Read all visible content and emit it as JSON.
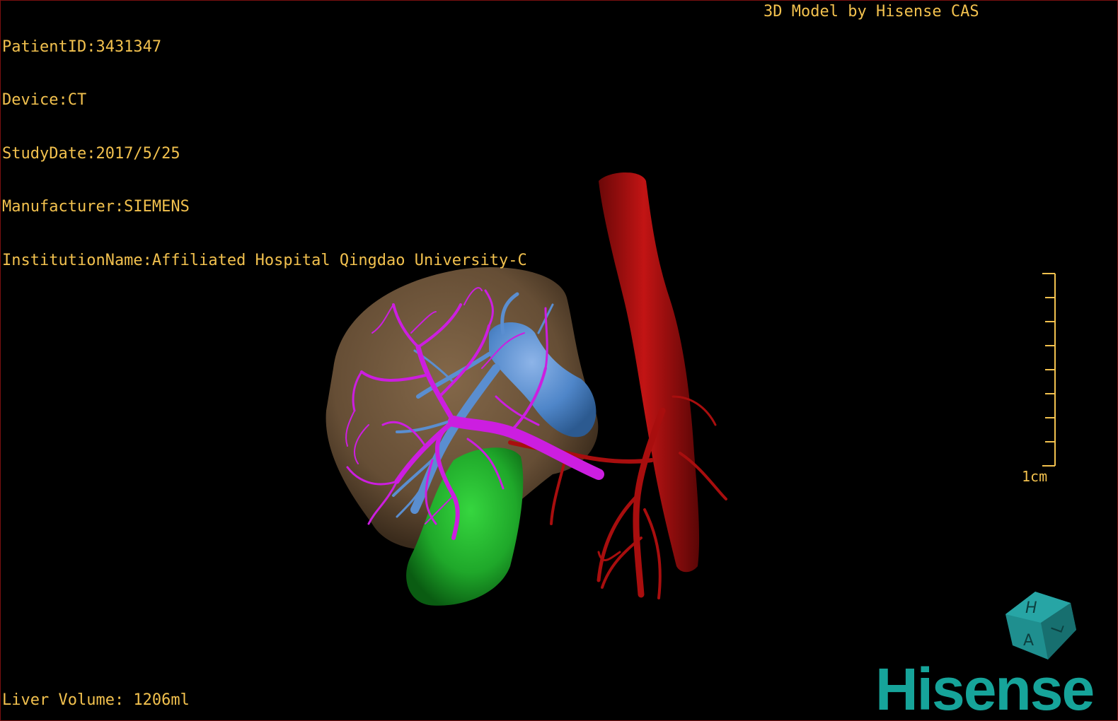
{
  "study_info": {
    "patient_id": "PatientID:3431347",
    "device": "Device:CT",
    "study_date": "StudyDate:2017/5/25",
    "manufacturer": "Manufacturer:SIEMENS",
    "institution": "InstitutionName:Affiliated Hospital Qingdao University-C"
  },
  "credit": "3D Model by Hisense CAS",
  "liver_volume": "Liver Volume: 1206ml",
  "scale_bar": {
    "label": "1cm"
  },
  "orientation_cube": {
    "icon": "orientation-cube-icon",
    "labels": [
      "H",
      "A",
      "L"
    ],
    "color": "#1f8f8f"
  },
  "brand": {
    "name": "Hisense",
    "color": "#16a49a"
  },
  "colors": {
    "overlay_text": "#f2c14e",
    "liver": "#6b5238",
    "portal_vein": "#cc1ee0",
    "hepatic_vein": "#4f86c9",
    "artery": "#b01010",
    "gallbladder": "#1fa82a"
  }
}
